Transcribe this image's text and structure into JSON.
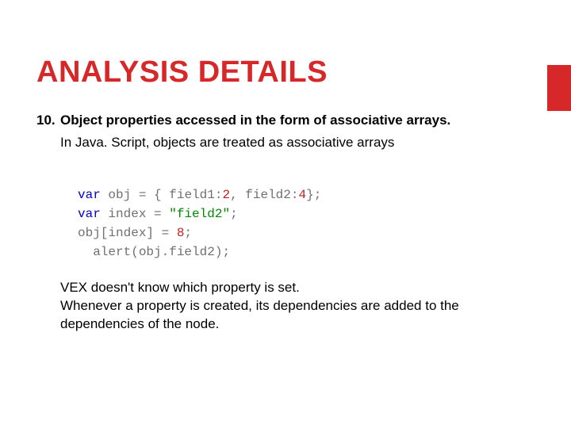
{
  "title": "ANALYSIS DETAILS",
  "item": {
    "number": "10.",
    "headline": "Object properties accessed in the form of associative arrays."
  },
  "explain": "In Java. Script, objects are treated as associative arrays",
  "code": {
    "l1": {
      "kw": "var",
      "rest_a": " obj ",
      "eq": "=",
      "rest_b": " { field1:",
      "n1": "2",
      "comma": ", field2:",
      "n2": "4",
      "close": "};"
    },
    "l2": {
      "kw": "var",
      "rest_a": " index ",
      "eq": "=",
      "sp": " ",
      "str": "\"field2\"",
      "semi": ";"
    },
    "l3": {
      "a": "obj[index] ",
      "eq": "=",
      "sp": " ",
      "num": "8",
      "semi": ";"
    },
    "l4": {
      "indent": "  ",
      "fn": "alert",
      "args": "(obj.field2);"
    }
  },
  "body1": "VEX doesn't know which property is set.",
  "body2": "Whenever a property is created, its dependencies are added to the dependencies of the node."
}
